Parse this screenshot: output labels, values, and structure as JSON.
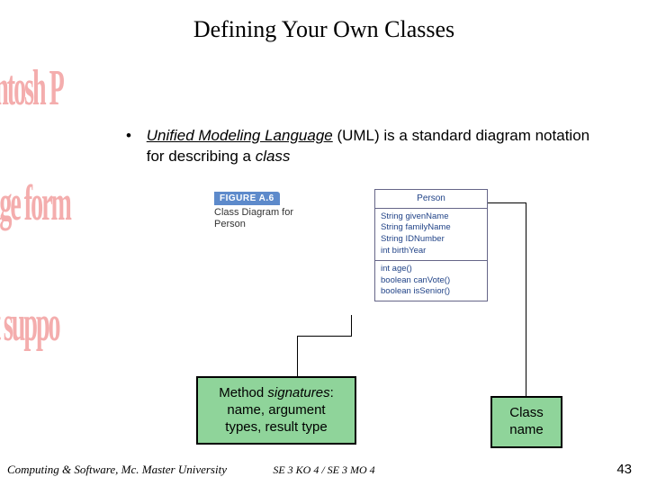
{
  "title": "Defining Your Own Classes",
  "bullet": {
    "term": "Unified Modeling Language",
    "abbr": " (UML) ",
    "rest": "is a standard diagram notation for describing a ",
    "rest2": "class"
  },
  "watermark": {
    "line1": "acintosh P",
    "line2": "mage form",
    "line3": "not suppo"
  },
  "figure": {
    "tag": "FIGURE A.6",
    "caption_l1": "Class Diagram for",
    "caption_l2": "Person"
  },
  "uml": {
    "classname": "Person",
    "attr1": "String givenName",
    "attr2": "String familyName",
    "attr3": "String IDNumber",
    "attr4": "int birthYear",
    "op1": "int age()",
    "op2": "boolean canVote()",
    "op3": "boolean isSenior()"
  },
  "callouts": {
    "methods_l1": "Method ",
    "methods_sig": "signatures",
    "methods_colon": ":",
    "methods_l2": "name, argument",
    "methods_l3": "types, result type",
    "classname_l1": "Class",
    "classname_l2": "name"
  },
  "footer": {
    "left": "Computing & Software, Mc. Master University",
    "center": "SE 3 KO 4 / SE 3 MO 4",
    "page": "43"
  }
}
